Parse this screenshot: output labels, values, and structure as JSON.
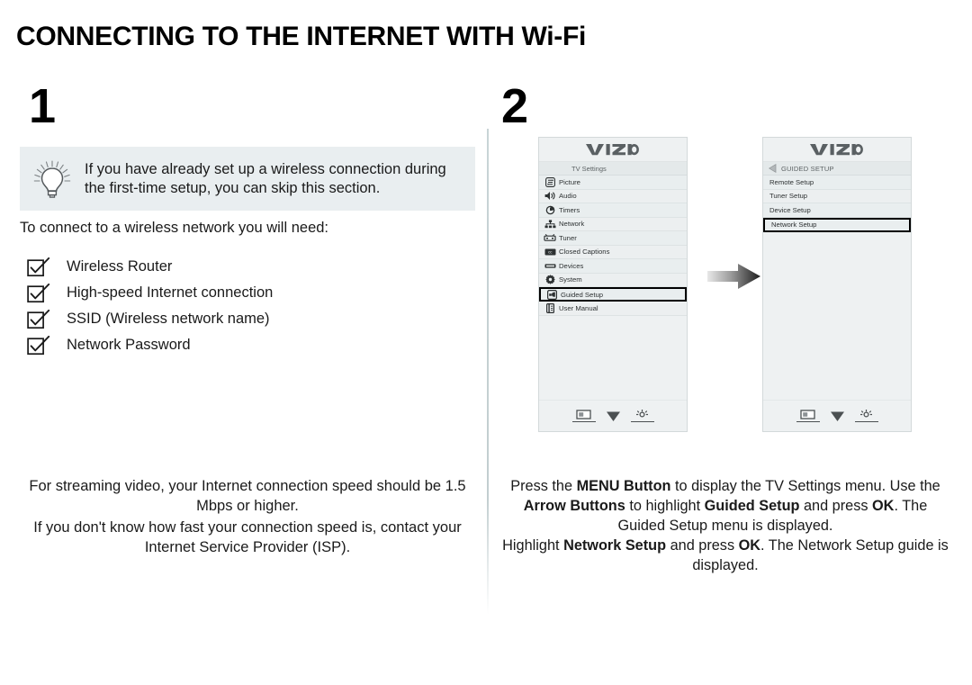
{
  "page": {
    "title": "CONNECTING TO THE INTERNET WITH Wi-Fi"
  },
  "steps": {
    "one": "1",
    "two": "2"
  },
  "tip": {
    "icon": "lightbulb-icon",
    "text": "If you have already set up a wireless connection during the first-time setup, you can skip this section."
  },
  "requirements": {
    "intro": "To connect to a wireless network you will need:",
    "items": [
      "Wireless Router",
      "High-speed Internet connection",
      "SSID (Wireless network name)",
      "Network Password"
    ]
  },
  "left_notes": {
    "note1": "For streaming video, your Internet connection speed should be 1.5 Mbps or higher.",
    "note2": "If you don't know how fast your connection speed is, contact your Internet Service Provider (ISP)."
  },
  "tv_menu_1": {
    "brand": "VIZIO",
    "header": "TV Settings",
    "items": [
      {
        "label": "Picture",
        "icon": "picture-icon"
      },
      {
        "label": "Audio",
        "icon": "speaker-icon"
      },
      {
        "label": "Timers",
        "icon": "clock-icon"
      },
      {
        "label": "Network",
        "icon": "network-icon"
      },
      {
        "label": "Tuner",
        "icon": "tuner-icon"
      },
      {
        "label": "Closed Captions",
        "icon": "closed-caption-icon"
      },
      {
        "label": "Devices",
        "icon": "devices-icon"
      },
      {
        "label": "System",
        "icon": "gear-icon"
      },
      {
        "label": "Guided Setup",
        "icon": "guided-setup-icon"
      },
      {
        "label": "User Manual",
        "icon": "manual-icon"
      }
    ],
    "selected": "Guided Setup",
    "footer_icons": [
      "screen-icon",
      "chevron-down-icon",
      "brightness-icon"
    ]
  },
  "tv_menu_2": {
    "brand": "VIZIO",
    "header": "GUIDED SETUP",
    "back_icon": "back-arrow-icon",
    "items": [
      {
        "label": "Remote Setup"
      },
      {
        "label": "Tuner Setup"
      },
      {
        "label": "Device Setup"
      },
      {
        "label": "Network Setup"
      }
    ],
    "selected": "Network Setup",
    "footer_icons": [
      "screen-icon",
      "chevron-down-icon",
      "brightness-icon"
    ]
  },
  "flow": {
    "arrow": "right-arrow-icon"
  },
  "right_notes": {
    "note1_parts": [
      {
        "t": "Press the ",
        "b": false
      },
      {
        "t": "MENU Button",
        "b": true
      },
      {
        "t": " to display the TV Settings menu. Use the ",
        "b": false
      },
      {
        "t": "Arrow Buttons",
        "b": true
      },
      {
        "t": " to highlight ",
        "b": false
      },
      {
        "t": "Guided Setup",
        "b": true
      },
      {
        "t": " and press ",
        "b": false
      },
      {
        "t": "OK",
        "b": true
      },
      {
        "t": ". The Guided Setup menu is displayed.",
        "b": false
      }
    ],
    "note2_parts": [
      {
        "t": "Highlight ",
        "b": false
      },
      {
        "t": "Network Setup",
        "b": true
      },
      {
        "t": " and press ",
        "b": false
      },
      {
        "t": "OK",
        "b": true
      },
      {
        "t": ". The Network Setup guide is displayed.",
        "b": false
      }
    ]
  },
  "colors": {
    "panel_bg": "#eef1f2",
    "row_bg": "#e9eeef",
    "tip_bg": "#e9eef0",
    "text": "#1a1a1a",
    "highlight_border": "#000000"
  }
}
